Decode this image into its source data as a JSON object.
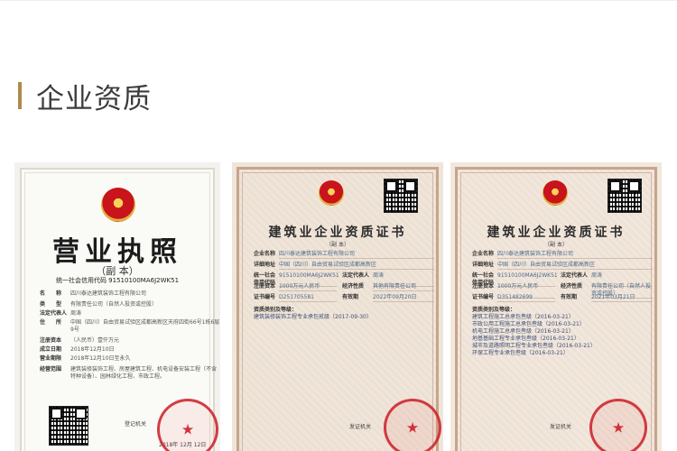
{
  "section": {
    "title": "企业资质"
  },
  "license": {
    "title": "营业执照",
    "subtitle": "（副 本）",
    "code": "统一社会信用代码 91510100MA6J2WK51",
    "fields": [
      {
        "k": "名　　称",
        "v": "四川泰达建筑装饰工程有限公司"
      },
      {
        "k": "类　　型",
        "v": "有限责任公司（自然人投资或控股）"
      },
      {
        "k": "法定代表人",
        "v": "周涛"
      },
      {
        "k": "住　　所",
        "v": "中国（四川）自由贸易试验区成都高新区天府四街66号1栋6层9号"
      },
      {
        "k": "注册资本",
        "v": "（人民币）壹仟万元"
      },
      {
        "k": "成立日期",
        "v": "2018年12月10日"
      },
      {
        "k": "营业期限",
        "v": "2018年12月10日至永久"
      },
      {
        "k": "经营范围",
        "v": "建筑装修装饰工程、房屋建筑工程、机电设备安装工程（不含特种设备）、园林绿化工程、市政工程。"
      }
    ],
    "registrar": "登记机关",
    "date": "2018年 12月 12日"
  },
  "certs": [
    {
      "title": "建筑业企业资质证书",
      "subtitle": "（副 本）",
      "fields": [
        {
          "k": "企业名称",
          "v": "四川泰达建筑装饰工程有限公司"
        },
        {
          "k": "详细地址",
          "v": "中国（四川）自由贸易试验区成都高新区"
        }
      ],
      "pairs": [
        {
          "k": "统一社会信用代码",
          "v": "91510100MA6J2WK51",
          "k2": "法定代表人",
          "v2": "周涛"
        },
        {
          "k": "注册资本",
          "v": "1000万元人民币",
          "k2": "经济性质",
          "v2": "其他有限责任公司"
        },
        {
          "k": "证书编号",
          "v": "D251705581",
          "k2": "有效期",
          "v2": "2022年09月20日"
        }
      ],
      "scope_head": "资质类别及等级：",
      "scope": [
        "建筑装修装饰工程专业承包贰级（2017-09-30）"
      ],
      "issuer": "发证机关"
    },
    {
      "title": "建筑业企业资质证书",
      "subtitle": "（副 本）",
      "fields": [
        {
          "k": "企业名称",
          "v": "四川泰达建筑装饰工程有限公司"
        },
        {
          "k": "详细地址",
          "v": "中国（四川）自由贸易试验区成都高新区"
        }
      ],
      "pairs": [
        {
          "k": "统一社会信用代码",
          "v": "91510100MA6J2WK51",
          "k2": "法定代表人",
          "v2": "周涛"
        },
        {
          "k": "注册资本",
          "v": "1000万元人民币",
          "k2": "经济性质",
          "v2": "有限责任公司（自然人投资或控股）"
        },
        {
          "k": "证书编号",
          "v": "D351482699",
          "k2": "有效期",
          "v2": "2021年03月21日"
        }
      ],
      "scope_head": "资质类别及等级：",
      "scope": [
        "建筑工程施工总承包叁级（2016-03-21）",
        "市政公用工程施工总承包叁级（2016-03-21）",
        "机电工程施工总承包叁级（2016-03-21）",
        "地基基础工程专业承包叁级（2016-03-21）",
        "城市及道路照明工程专业承包叁级（2016-03-21）",
        "环保工程专业承包叁级（2016-03-21）"
      ],
      "issuer": "发证机关"
    }
  ]
}
